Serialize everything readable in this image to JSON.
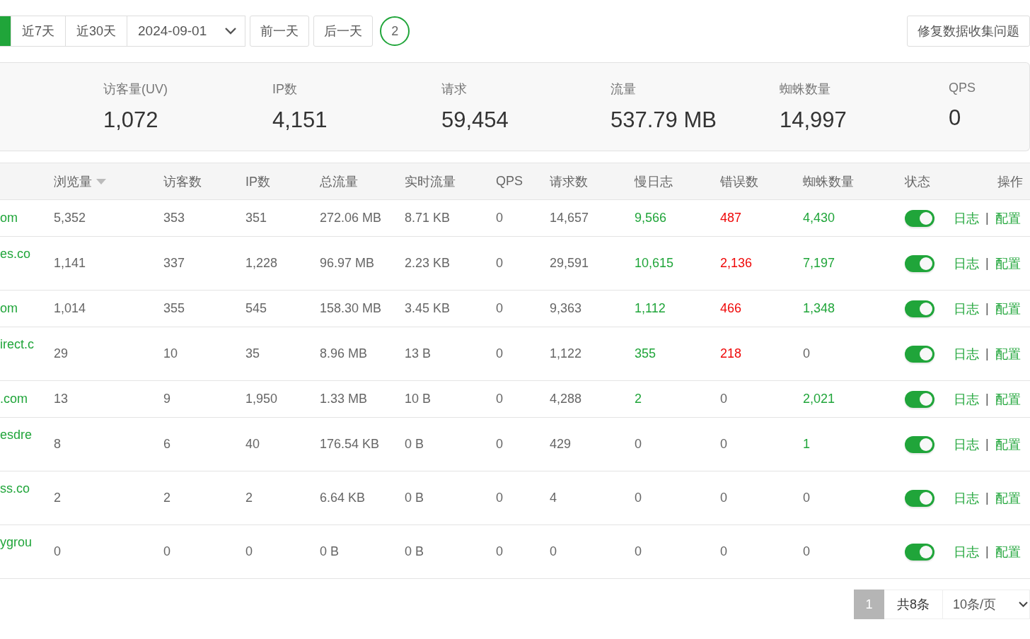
{
  "toolbar": {
    "range_tabs": [
      {
        "selected": true
      },
      {
        "label": "近7天",
        "selected": false
      },
      {
        "label": "近30天",
        "selected": false
      }
    ],
    "date_select": {
      "value": "2024-09-01"
    },
    "buttons": [
      "前一天",
      "后一天"
    ],
    "badge": "2",
    "repair_button": "修复数据收集问题"
  },
  "stats": [
    {
      "label": "访客量(UV)",
      "value": "1,072"
    },
    {
      "label": "IP数",
      "value": "4,151"
    },
    {
      "label": "请求",
      "value": "59,454"
    },
    {
      "label": "流量",
      "value": "537.79 MB"
    },
    {
      "label": "蜘蛛数量",
      "value": "14,997"
    },
    {
      "label": "QPS",
      "value": "0"
    }
  ],
  "table": {
    "columns": [
      {
        "label": "浏览量",
        "sorted": true
      },
      {
        "label": "访客数"
      },
      {
        "label": "IP数"
      },
      {
        "label": "总流量"
      },
      {
        "label": "实时流量"
      },
      {
        "label": "QPS"
      },
      {
        "label": "请求数"
      },
      {
        "label": "慢日志"
      },
      {
        "label": "错误数"
      },
      {
        "label": "蜘蛛数量"
      },
      {
        "label": "状态"
      },
      {
        "label": "操作"
      }
    ],
    "rows": [
      {
        "site": "om",
        "wrapped": false,
        "cells": [
          "5,352",
          "353",
          "351",
          "272.06 MB",
          "8.71 KB",
          "0",
          "14,657"
        ],
        "slow": {
          "value": "9,566",
          "highlight": true
        },
        "errors": {
          "value": "487",
          "highlight": true
        },
        "spiders": {
          "value": "4,430",
          "highlight": true
        },
        "enabled": true,
        "actions": [
          "日志",
          "配置"
        ],
        "separator": "|"
      },
      {
        "site": "es.co",
        "wrapped": true,
        "cells": [
          "1,141",
          "337",
          "1,228",
          "96.97 MB",
          "2.23 KB",
          "0",
          "29,591"
        ],
        "slow": {
          "value": "10,615",
          "highlight": true
        },
        "errors": {
          "value": "2,136",
          "highlight": true
        },
        "spiders": {
          "value": "7,197",
          "highlight": true
        },
        "enabled": true,
        "actions": [
          "日志",
          "配置"
        ],
        "separator": "|"
      },
      {
        "site": "om",
        "wrapped": false,
        "cells": [
          "1,014",
          "355",
          "545",
          "158.30 MB",
          "3.45 KB",
          "0",
          "9,363"
        ],
        "slow": {
          "value": "1,112",
          "highlight": true
        },
        "errors": {
          "value": "466",
          "highlight": true
        },
        "spiders": {
          "value": "1,348",
          "highlight": true
        },
        "enabled": true,
        "actions": [
          "日志",
          "配置"
        ],
        "separator": "|"
      },
      {
        "site": "irect.c",
        "wrapped": true,
        "cells": [
          "29",
          "10",
          "35",
          "8.96 MB",
          "13 B",
          "0",
          "1,122"
        ],
        "slow": {
          "value": "355",
          "highlight": true
        },
        "errors": {
          "value": "218",
          "highlight": true
        },
        "spiders": {
          "value": "0",
          "highlight": false
        },
        "enabled": true,
        "actions": [
          "日志",
          "配置"
        ],
        "separator": "|"
      },
      {
        "site": ".com",
        "wrapped": false,
        "cells": [
          "13",
          "9",
          "1,950",
          "1.33 MB",
          "10 B",
          "0",
          "4,288"
        ],
        "slow": {
          "value": "2",
          "highlight": true
        },
        "errors": {
          "value": "0",
          "highlight": false
        },
        "spiders": {
          "value": "2,021",
          "highlight": true
        },
        "enabled": true,
        "actions": [
          "日志",
          "配置"
        ],
        "separator": "|"
      },
      {
        "site": "esdre",
        "wrapped": true,
        "cells": [
          "8",
          "6",
          "40",
          "176.54 KB",
          "0 B",
          "0",
          "429"
        ],
        "slow": {
          "value": "0",
          "highlight": false
        },
        "errors": {
          "value": "0",
          "highlight": false
        },
        "spiders": {
          "value": "1",
          "highlight": true
        },
        "enabled": true,
        "actions": [
          "日志",
          "配置"
        ],
        "separator": "|"
      },
      {
        "site": "ss.co",
        "wrapped": true,
        "cells": [
          "2",
          "2",
          "2",
          "6.64 KB",
          "0 B",
          "0",
          "4"
        ],
        "slow": {
          "value": "0",
          "highlight": false
        },
        "errors": {
          "value": "0",
          "highlight": false
        },
        "spiders": {
          "value": "0",
          "highlight": false
        },
        "enabled": true,
        "actions": [
          "日志",
          "配置"
        ],
        "separator": "|"
      },
      {
        "site": "ygrou",
        "wrapped": true,
        "cells": [
          "0",
          "0",
          "0",
          "0 B",
          "0 B",
          "0",
          "0"
        ],
        "slow": {
          "value": "0",
          "highlight": false
        },
        "errors": {
          "value": "0",
          "highlight": false
        },
        "spiders": {
          "value": "0",
          "highlight": false
        },
        "enabled": true,
        "actions": [
          "日志",
          "配置"
        ],
        "separator": "|"
      }
    ]
  },
  "pagination": {
    "pages": [
      {
        "label": "1",
        "selected": true
      }
    ],
    "total": "共8条",
    "page_size": "10条/页"
  }
}
